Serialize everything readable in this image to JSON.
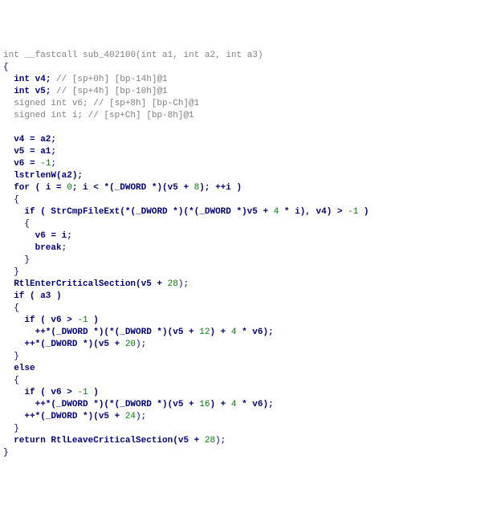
{
  "code": {
    "sig_pre": "int __fastcall ",
    "fn_name": "sub_402100",
    "sig_post_open": "(",
    "sig_int_a": "int",
    "a1": " a1",
    "comma": ", ",
    "sig_int_b": "int",
    "a2": " a2",
    "sig_int_c": "int",
    "a3": " a3",
    "sig_post_close": ")",
    "brace_open": "{",
    "decl_int_a": "  int",
    "v4_decl": " v4; ",
    "v4_comment": "// [sp+0h] [bp-14h]@1",
    "decl_int_b": "  int",
    "v5_decl": " v5; ",
    "v5_comment": "// [sp+4h] [bp-10h]@1",
    "decl_signed_a": "  signed int v6; ",
    "v6_comment": "// [sp+8h] [bp-Ch]@1",
    "decl_signed_b": "  signed int i; ",
    "i_comment": "// [sp+Ch] [bp-8h]@1",
    "blank": "",
    "v4_assign_pre": "  v4 = a2;",
    "v5_assign_pre": "  v5 = a1;",
    "v6_assign_pre": "  v6 = ",
    "neg1": "-1",
    "semi": ";",
    "lstrlen_pre": "  ",
    "lstrlen_name": "lstrlenW",
    "lstrlen_post": "(a2);",
    "for_pre": "  for",
    "for_open": " ( i = ",
    "zero": "0",
    "for_mid1": "; i < *(_DWORD *)(v5 + ",
    "eight": "8",
    "for_mid2": "); ++i )",
    "for_body_open": "  {",
    "if1_pre": "    if",
    "if1_open": " ( ",
    "strcmp_name": "StrCmpFileExt",
    "if1_mid1": "(*(_DWORD *)(*(_DWORD *)v5 + ",
    "four": "4",
    "if1_mid2": " * i), v4) > ",
    "if1_mid3": " )",
    "if1_body_open": "    {",
    "v6_eq_i": "      v6 = i;",
    "break_pre": "      ",
    "break_kw": "break",
    "if1_body_close": "    }",
    "for_body_close": "  }",
    "enter_pre": "  ",
    "enter_name": "RtlEnterCriticalSection",
    "enter_post_open": "(v5 + ",
    "twentyeight": "28",
    "paren_semi": ");",
    "if_a3_pre": "  if",
    "if_a3_post": " ( a3 )",
    "block_open2": "  {",
    "if2_pre": "    if",
    "if2_open": " ( v6 > ",
    "if2_close": " )",
    "inc1_pre": "      ++*(_DWORD *)(*(_DWORD *)(v5 + ",
    "twelve": "12",
    "inc1_mid": ") + ",
    "inc1_mid2": " * v6);",
    "inc2_pre": "    ++*(_DWORD *)(v5 + ",
    "twenty": "20",
    "block_close2": "  }",
    "else_pre": "  ",
    "else_kw": "else",
    "block_open3": "  {",
    "if3_pre": "    if",
    "if3_open": " ( v6 > ",
    "if3_close": " )",
    "inc3_pre": "      ++*(_DWORD *)(*(_DWORD *)(v5 + ",
    "sixteen": "16",
    "inc3_mid": ") + ",
    "inc3_mid2": " * v6);",
    "inc4_pre": "    ++*(_DWORD *)(v5 + ",
    "twentyfour": "24",
    "block_close3": "  }",
    "return_pre": "  ",
    "return_kw": "return",
    "return_sp": " ",
    "leave_name": "RtlLeaveCriticalSection",
    "leave_post_open": "(v5 + ",
    "brace_close": "}"
  }
}
